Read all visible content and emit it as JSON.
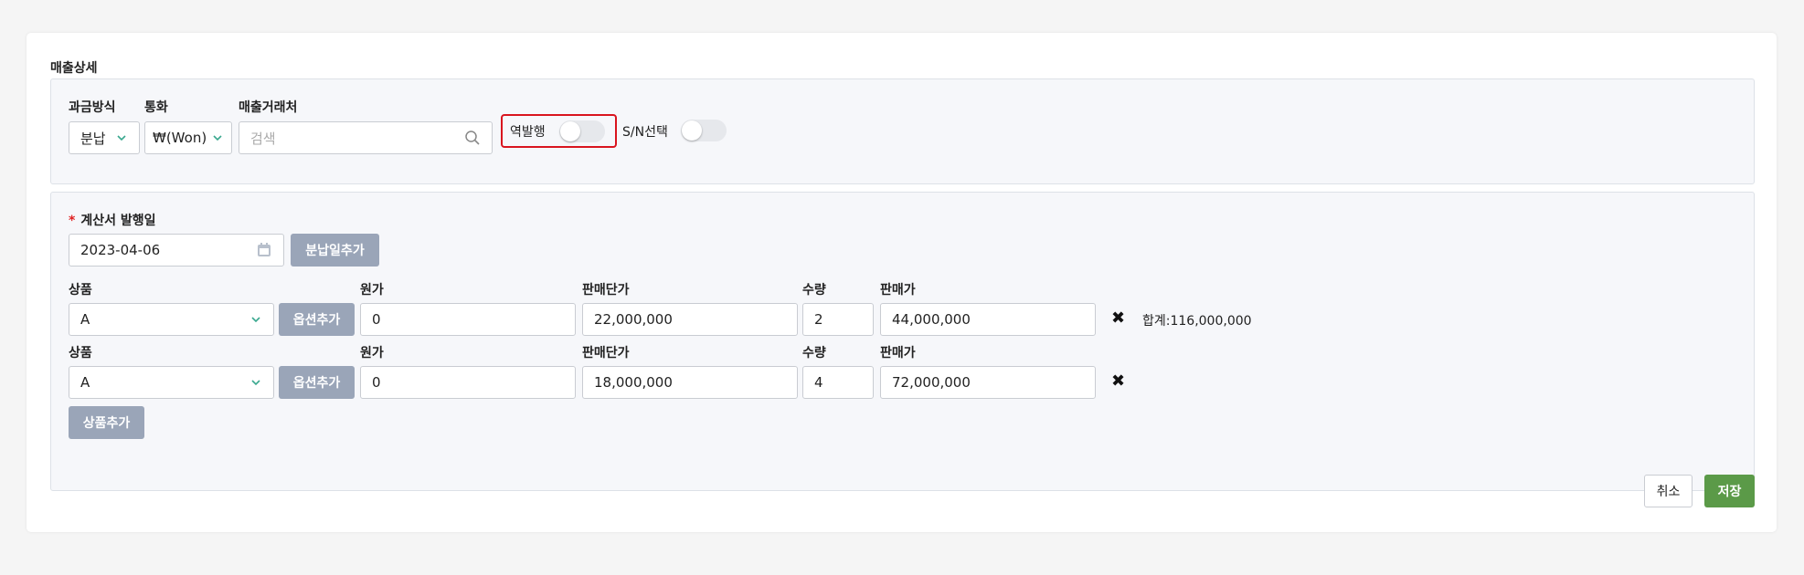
{
  "section_title": "매출상세",
  "billing": {
    "method_label": "과금방식",
    "method_value": "분납",
    "currency_label": "통화",
    "currency_value": "₩(Won)",
    "client_label": "매출거래처",
    "client_placeholder": "검색",
    "reverse_issue_label": "역발행",
    "reverse_issue_on": false,
    "sn_select_label": "S/N선택",
    "sn_select_on": false
  },
  "invoice": {
    "date_label": "계산서 발행일",
    "required_mark": "*",
    "date_value": "2023-04-06",
    "add_installment_button": "분납일추가"
  },
  "product_headers": {
    "product": "상품",
    "cost": "원가",
    "unit_price": "판매단가",
    "quantity": "수량",
    "sale_price": "판매가"
  },
  "rows": [
    {
      "product": "A",
      "option_button": "옵션추가",
      "cost": "0",
      "unit_price": "22,000,000",
      "quantity": "2",
      "sale_price": "44,000,000",
      "remove": "✖"
    },
    {
      "product": "A",
      "option_button": "옵션추가",
      "cost": "0",
      "unit_price": "18,000,000",
      "quantity": "4",
      "sale_price": "72,000,000",
      "remove": "✖"
    }
  ],
  "total_text": "합계:116,000,000",
  "add_product_button": "상품추가",
  "footer": {
    "cancel_button": "취소",
    "save_button": "저장"
  },
  "colors": {
    "save_green": "#5b9a48",
    "gray_button": "#9aa5b8",
    "highlight_red": "#d9141e"
  }
}
